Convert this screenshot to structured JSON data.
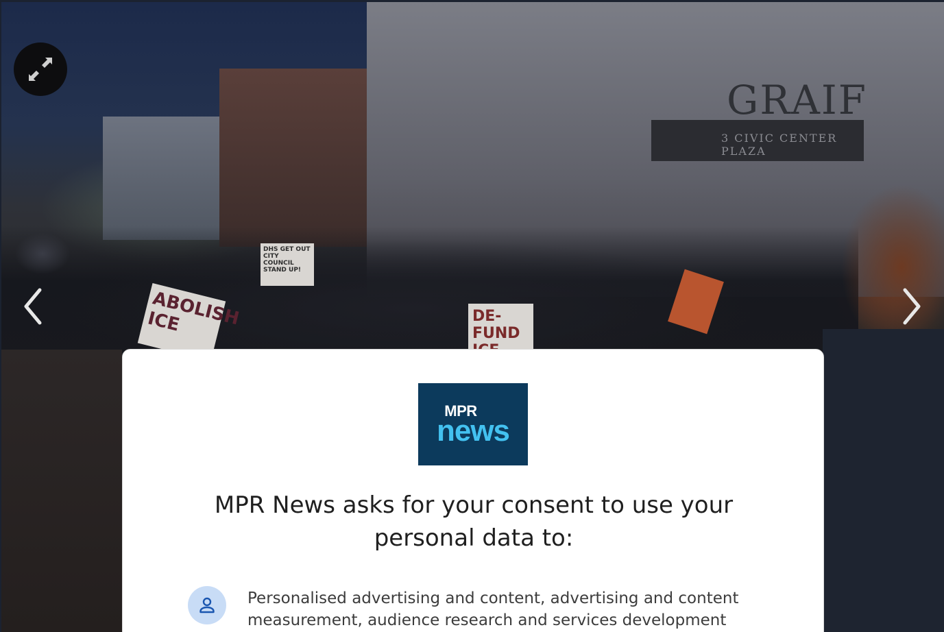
{
  "photo": {
    "building_sign": "GRAIF",
    "building_address": "3 CIVIC CENTER PLAZA",
    "protest_signs": [
      "ABOLISH ICE",
      "DE-FUND ICE",
      "DHS GET OUT CITY COUNCIL STAND UP!"
    ]
  },
  "gallery": {
    "expand_icon": "expand-arrows-icon",
    "prev_icon": "chevron-left-icon",
    "next_icon": "chevron-right-icon"
  },
  "consent": {
    "logo_line1": "MPR",
    "logo_line2": "news",
    "title": "MPR News asks for your consent to use your personal data to:",
    "purposes": [
      {
        "icon": "person-icon",
        "text": "Personalised advertising and content, advertising and content measurement, audience research and services development"
      }
    ]
  },
  "colors": {
    "logo_background": "#0c3a5c",
    "logo_news": "#43c1f0",
    "purpose_icon_bg": "#c8dcf6",
    "purpose_icon_fg": "#1a56b0"
  }
}
